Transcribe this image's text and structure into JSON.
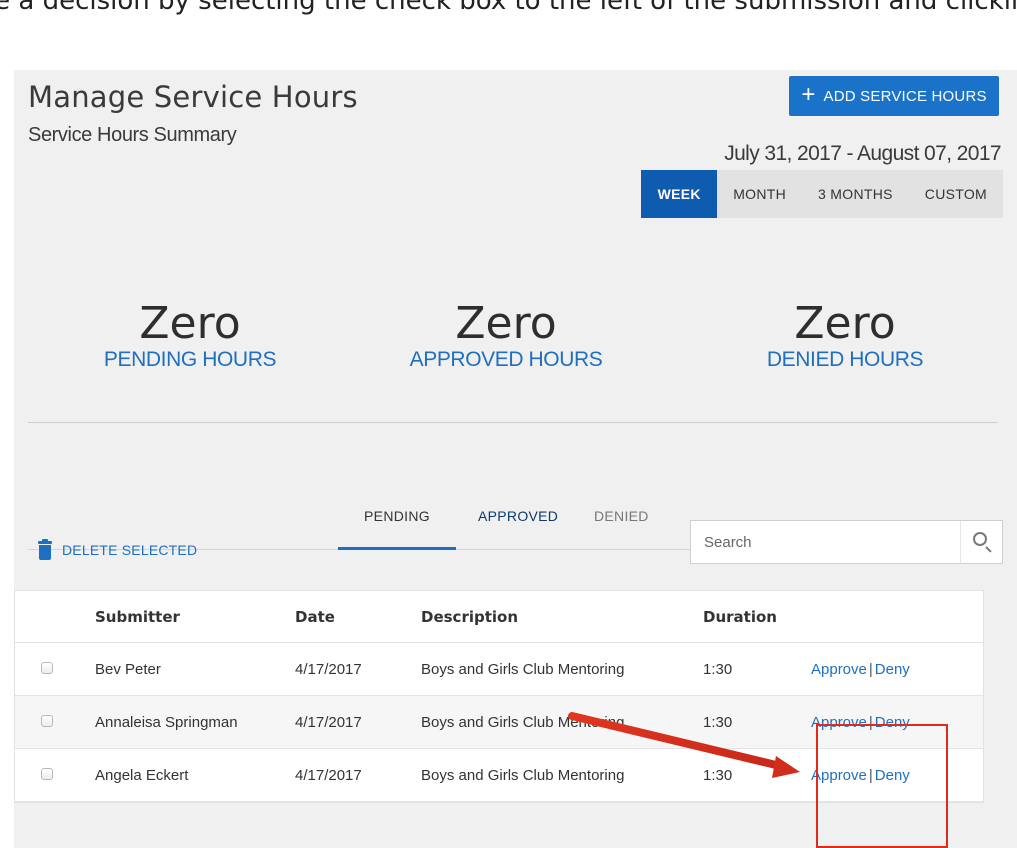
{
  "caption": "ke a decision by selecting the check box to the left of the submission and clickin",
  "header": {
    "title": "Manage Service Hours",
    "subtitle": "Service Hours Summary",
    "add_button_label": "ADD SERVICE HOURS",
    "add_button_icon": "plus-icon",
    "date_range": "July 31, 2017 - August 07, 2017"
  },
  "range_tabs": [
    {
      "label": "WEEK",
      "active": true
    },
    {
      "label": "MONTH",
      "active": false
    },
    {
      "label": "3 MONTHS",
      "active": false
    },
    {
      "label": "CUSTOM",
      "active": false
    }
  ],
  "stats": [
    {
      "value": "Zero",
      "label": "PENDING HOURS"
    },
    {
      "value": "Zero",
      "label": "APPROVED HOURS"
    },
    {
      "value": "Zero",
      "label": "DENIED HOURS"
    }
  ],
  "status_tabs": [
    {
      "label": "PENDING",
      "active": true
    },
    {
      "label": "APPROVED",
      "active": false
    },
    {
      "label": "DENIED",
      "active": false
    }
  ],
  "toolbar": {
    "delete_label": "DELETE SELECTED",
    "delete_icon": "trash-icon",
    "search_placeholder": "Search",
    "search_icon": "search-icon"
  },
  "table": {
    "columns": [
      "",
      "Submitter",
      "Date",
      "Description",
      "Duration",
      ""
    ],
    "rows": [
      {
        "submitter": "Bev Peter",
        "date": "4/17/2017",
        "description": "Boys and Girls Club Mentoring",
        "duration": "1:30",
        "approve": "Approve",
        "separator": "|",
        "deny": "Deny"
      },
      {
        "submitter": "Annaleisa Springman",
        "date": "4/17/2017",
        "description": "Boys and Girls Club Mentoring",
        "duration": "1:30",
        "approve": "Approve",
        "separator": "|",
        "deny": "Deny"
      },
      {
        "submitter": "Angela Eckert",
        "date": "4/17/2017",
        "description": "Boys and Girls Club Mentoring",
        "duration": "1:30",
        "approve": "Approve",
        "separator": "|",
        "deny": "Deny"
      }
    ]
  },
  "colors": {
    "primary_blue": "#1a73c9",
    "active_tab_blue": "#0f5bb0",
    "link_blue": "#1f6fc1",
    "annotation_red": "#e22a1c"
  }
}
